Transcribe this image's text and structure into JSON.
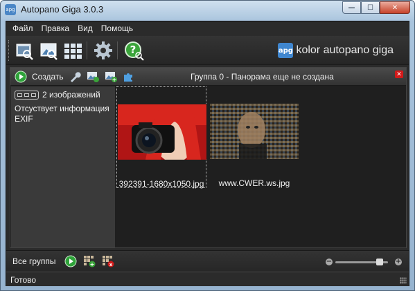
{
  "window": {
    "title": "Autopano Giga 3.0.3",
    "app_icon": "apg",
    "minimize_glyph": "—",
    "maximize_glyph": "☐",
    "close_glyph": "✕"
  },
  "menu": [
    {
      "label": "Файл"
    },
    {
      "label": "Правка"
    },
    {
      "label": "Вид"
    },
    {
      "label": "Помощь"
    }
  ],
  "toolbar": {
    "icons": [
      "select-folder-icon",
      "import-images-icon",
      "detect-panoramas-icon",
      "settings-gear-icon",
      "help-icon"
    ],
    "brand_badge": "apg",
    "brand_text": "kolor autopano giga"
  },
  "group": {
    "create_label": "Создать",
    "title": "Группа 0 - Панорама еще не создана",
    "close_glyph": "✕",
    "info": {
      "image_count": "2 изображений",
      "exif": "Отсуствует информация EXIF"
    },
    "images": [
      {
        "name": "392391-1680x1050.jpg",
        "selected": true
      },
      {
        "name": "www.CWER.ws.jpg",
        "selected": false
      }
    ]
  },
  "bottom": {
    "all_groups_label": "Все группы",
    "zoom_minus": "−",
    "zoom_plus": "+",
    "zoom_level": 0.9
  },
  "status": {
    "text": "Готово"
  },
  "colors": {
    "accent": "#3f86cf",
    "play_green": "#2fa33a",
    "close_red": "#d21a1a"
  }
}
